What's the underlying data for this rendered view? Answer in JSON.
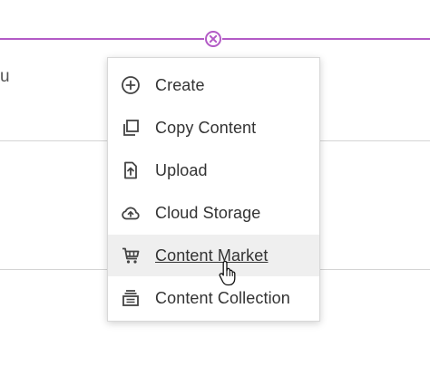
{
  "background": {
    "partial_text": "u"
  },
  "menu": {
    "items": [
      {
        "label": "Create",
        "icon": "add-circle-icon"
      },
      {
        "label": "Copy Content",
        "icon": "copy-icon"
      },
      {
        "label": "Upload",
        "icon": "upload-icon"
      },
      {
        "label": "Cloud Storage",
        "icon": "cloud-upload-icon"
      },
      {
        "label": "Content Market",
        "icon": "cart-icon",
        "hovered": true
      },
      {
        "label": "Content Collection",
        "icon": "collection-icon"
      }
    ]
  },
  "colors": {
    "accent": "#b35bc6",
    "text": "#333333",
    "hover_bg": "#efefef"
  }
}
